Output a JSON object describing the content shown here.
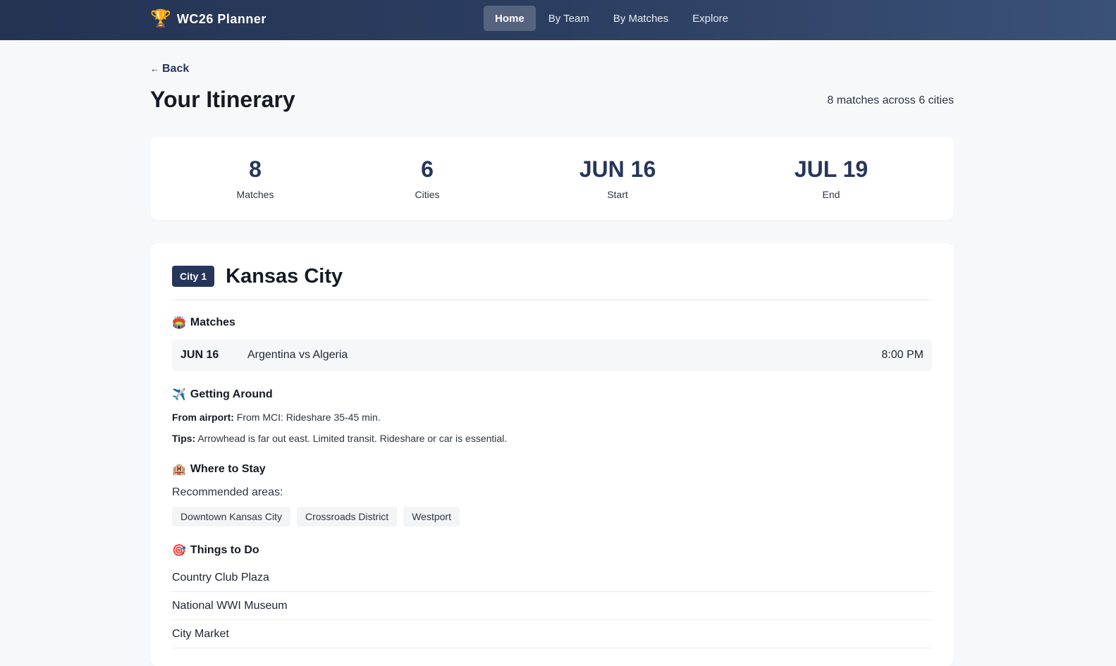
{
  "nav": {
    "brand": "WC26 Planner",
    "brand_icon": "trophy-icon",
    "links": [
      {
        "label": "Home",
        "active": true
      },
      {
        "label": "By Team",
        "active": false
      },
      {
        "label": "By Matches",
        "active": false
      },
      {
        "label": "Explore",
        "active": false
      }
    ]
  },
  "page": {
    "back_label": "Back",
    "title": "Your Itinerary",
    "summary": "8 matches across 6 cities"
  },
  "stats": [
    {
      "value": "8",
      "label": "Matches"
    },
    {
      "value": "6",
      "label": "Cities"
    },
    {
      "value": "JUN 16",
      "label": "Start"
    },
    {
      "value": "JUL 19",
      "label": "End"
    }
  ],
  "city": {
    "badge": "City 1",
    "name": "Kansas City",
    "matches_title": "Matches",
    "matches": [
      {
        "date": "JUN 16",
        "teams": "Argentina vs Algeria",
        "time": "8:00 PM"
      }
    ],
    "getting_around_title": "Getting Around",
    "from_airport_label": "From airport:",
    "from_airport": "From MCI: Rideshare 35-45 min.",
    "tips_label": "Tips:",
    "tips": "Arrowhead is far out east. Limited transit. Rideshare or car is essential.",
    "stay_title": "Where to Stay",
    "areas_label": "Recommended areas:",
    "areas": [
      "Downtown Kansas City",
      "Crossroads District",
      "Westport"
    ],
    "todo_title": "Things to Do",
    "todo": [
      "Country Club Plaza",
      "National WWI Museum",
      "City Market"
    ]
  },
  "colors": {
    "nav_start": "#243352",
    "nav_end": "#3a5178",
    "accent": "#26365a",
    "background": "#f7f8fa"
  }
}
